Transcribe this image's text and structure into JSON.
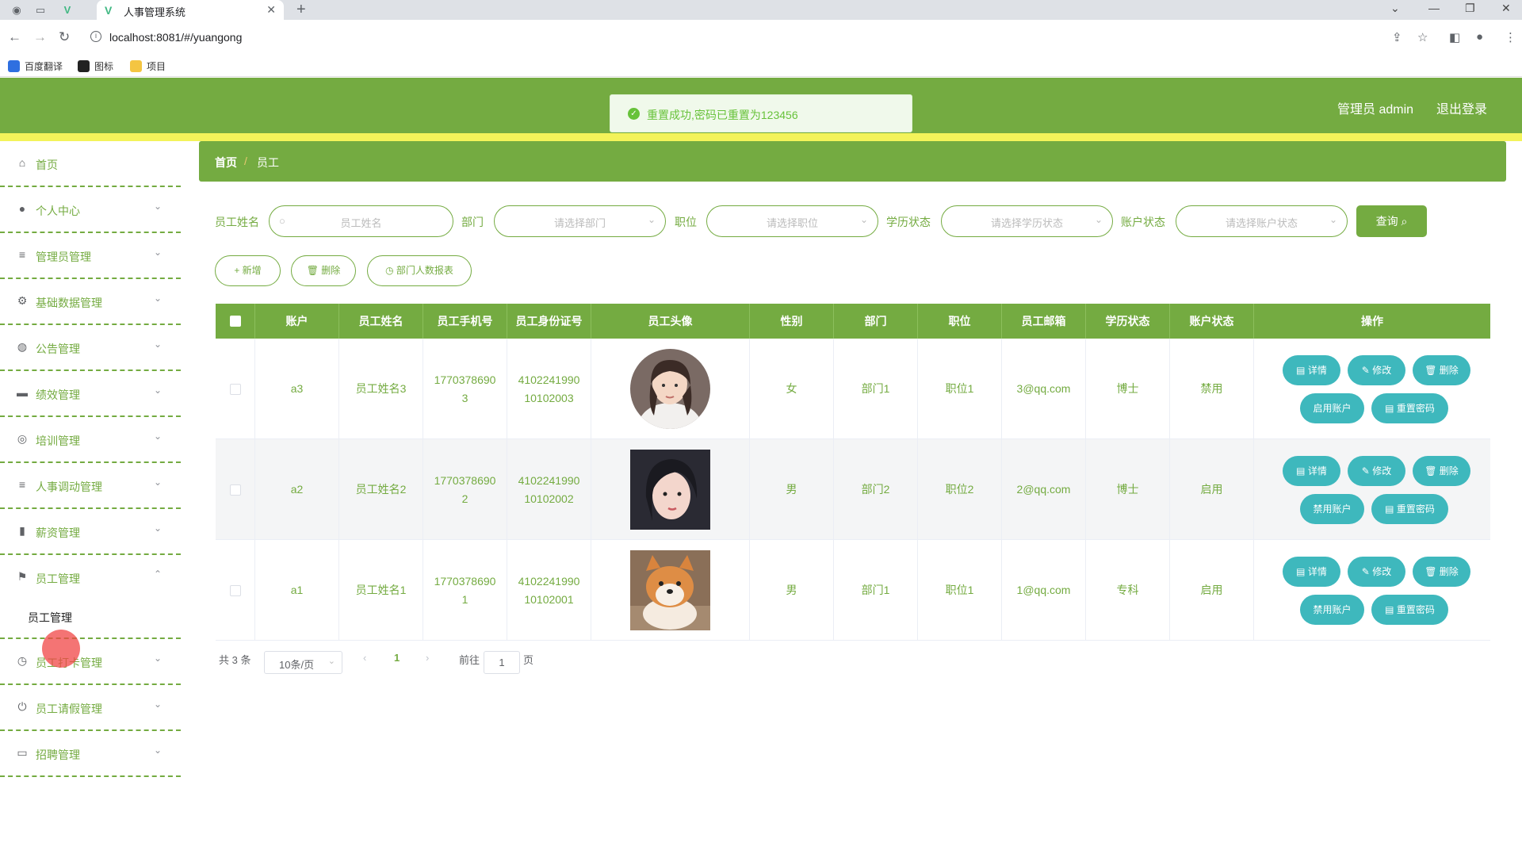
{
  "browser": {
    "tab_title": "人事管理系统",
    "url": "localhost:8081/#/yuangong",
    "bookmarks": [
      "百度翻译",
      "图标",
      "项目"
    ]
  },
  "header": {
    "toast": "重置成功,密码已重置为123456",
    "user": "管理员 admin",
    "logout": "退出登录"
  },
  "sidebar": {
    "items": [
      {
        "label": "首页",
        "icon": "home-icon"
      },
      {
        "label": "个人中心",
        "icon": "user-icon"
      },
      {
        "label": "管理员管理",
        "icon": "list-icon"
      },
      {
        "label": "基础数据管理",
        "icon": "settings-icon"
      },
      {
        "label": "公告管理",
        "icon": "bulb-icon"
      },
      {
        "label": "绩效管理",
        "icon": "chat-icon"
      },
      {
        "label": "培训管理",
        "icon": "compass-icon"
      },
      {
        "label": "人事调动管理",
        "icon": "list-icon"
      },
      {
        "label": "薪资管理",
        "icon": "chart-icon"
      },
      {
        "label": "员工管理",
        "icon": "flag-icon"
      },
      {
        "label": "员工打卡管理",
        "icon": "clock-icon"
      },
      {
        "label": "员工请假管理",
        "icon": "power-icon"
      },
      {
        "label": "招聘管理",
        "icon": "card-icon"
      }
    ],
    "submenu_item": "员工管理"
  },
  "breadcrumb": {
    "home": "首页",
    "separator": "/",
    "current": "员工"
  },
  "filters": {
    "name_label": "员工姓名",
    "name_placeholder": "员工姓名",
    "dept_label": "部门",
    "dept_placeholder": "请选择部门",
    "pos_label": "职位",
    "pos_placeholder": "请选择职位",
    "edu_label": "学历状态",
    "edu_placeholder": "请选择学历状态",
    "acct_label": "账户状态",
    "acct_placeholder": "请选择账户状态",
    "query": "查询"
  },
  "actions": {
    "add": "新增",
    "delete": "删除",
    "report": "部门人数报表"
  },
  "table": {
    "headers": [
      "账户",
      "员工姓名",
      "员工手机号",
      "员工身份证号",
      "员工头像",
      "性别",
      "部门",
      "职位",
      "员工邮箱",
      "学历状态",
      "账户状态",
      "操作"
    ],
    "rows": [
      {
        "account": "a3",
        "name": "员工姓名3",
        "phone_a": "1770378690",
        "phone_b": "3",
        "id_a": "4102241990",
        "id_b": "10102003",
        "gender": "女",
        "dept": "部门1",
        "pos": "职位1",
        "email": "3@qq.com",
        "edu": "博士",
        "status": "禁用",
        "toggle": "启用账户"
      },
      {
        "account": "a2",
        "name": "员工姓名2",
        "phone_a": "1770378690",
        "phone_b": "2",
        "id_a": "4102241990",
        "id_b": "10102002",
        "gender": "男",
        "dept": "部门2",
        "pos": "职位2",
        "email": "2@qq.com",
        "edu": "博士",
        "status": "启用",
        "toggle": "禁用账户"
      },
      {
        "account": "a1",
        "name": "员工姓名1",
        "phone_a": "1770378690",
        "phone_b": "1",
        "id_a": "4102241990",
        "id_b": "10102001",
        "gender": "男",
        "dept": "部门1",
        "pos": "职位1",
        "email": "1@qq.com",
        "edu": "专科",
        "status": "启用",
        "toggle": "禁用账户"
      }
    ],
    "op_labels": {
      "detail": "详情",
      "edit": "修改",
      "delete": "删除",
      "reset": "重置密码"
    }
  },
  "pagination": {
    "total": "共 3 条",
    "page_size": "10条/页",
    "current": "1",
    "goto_label": "前往",
    "goto_value": "1",
    "page_suffix": "页"
  },
  "colors": {
    "primary": "#74ab41",
    "accent_yellow": "#f3f35a",
    "teal": "#3eb8bd"
  }
}
